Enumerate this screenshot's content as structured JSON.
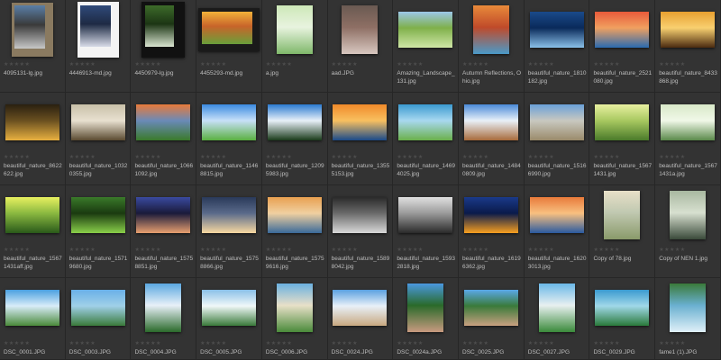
{
  "browser": {
    "rating_glyphs": "★★★★★",
    "items": [
      {
        "name": "4095131-lg.jpg",
        "orient": "port",
        "frame": "grey",
        "colors": [
          "#5a7fa8",
          "#c7c7c7",
          "#3a3a3a"
        ]
      },
      {
        "name": "4446913-md.jpg",
        "orient": "port",
        "frame": "white",
        "colors": [
          "#2f4a7a",
          "#d8dce8",
          "#1e2a44"
        ]
      },
      {
        "name": "4450979-lg.jpg",
        "orient": "port",
        "frame": "black",
        "colors": [
          "#3d6b2a",
          "#d9e4d0",
          "#1c3514"
        ]
      },
      {
        "name": "4455293-md.jpg",
        "orient": "land",
        "frame": "dark",
        "colors": [
          "#f2b13a",
          "#6aa03a",
          "#c8642a"
        ]
      },
      {
        "name": "a.jpg",
        "orient": "port",
        "frame": "none",
        "colors": [
          "#cde8b8",
          "#7fb86a",
          "#e8f3df"
        ]
      },
      {
        "name": "aad.JPG",
        "orient": "port",
        "frame": "none",
        "colors": [
          "#6a5a52",
          "#d8c8c0",
          "#8e6f64"
        ]
      },
      {
        "name": "Amazing_Landscape_131.jpg",
        "orient": "land",
        "frame": "none",
        "colors": [
          "#9cc8e8",
          "#cfe6a6",
          "#7fb04a"
        ]
      },
      {
        "name": "Autumn Reflections, Ohio.jpg",
        "orient": "port",
        "frame": "none",
        "colors": [
          "#e88a3a",
          "#4a9ac8",
          "#c04a2a"
        ]
      },
      {
        "name": "beautiful_nature_1810182.jpg",
        "orient": "land",
        "frame": "none",
        "colors": [
          "#1a4a8a",
          "#8ac0e8",
          "#0a2a5a"
        ]
      },
      {
        "name": "beautiful_nature_2521080.jpg",
        "orient": "land",
        "frame": "none",
        "colors": [
          "#e85a3a",
          "#2a6ab0",
          "#f0a060"
        ]
      },
      {
        "name": "beautiful_nature_8433868.jpg",
        "orient": "land",
        "frame": "none",
        "colors": [
          "#e8a030",
          "#4a2a10",
          "#f8d070"
        ]
      },
      {
        "name": "beautiful_nature_8622622.jpg",
        "orient": "land",
        "frame": "none",
        "colors": [
          "#2a2010",
          "#e8b040",
          "#6a5020"
        ]
      },
      {
        "name": "beautiful_nature_10320355.jpg",
        "orient": "land",
        "frame": "none",
        "colors": [
          "#c8c0a8",
          "#5a4a30",
          "#e8e0d0"
        ]
      },
      {
        "name": "beautiful_nature_10661092.jpg",
        "orient": "land",
        "frame": "none",
        "colors": [
          "#e87a3a",
          "#3a7a2a",
          "#6a8ab8"
        ]
      },
      {
        "name": "beautiful_nature_11468815.jpg",
        "orient": "land",
        "frame": "none",
        "colors": [
          "#3a8ae0",
          "#5ab040",
          "#c8e0f8"
        ]
      },
      {
        "name": "beautiful_nature_12095983.jpg",
        "orient": "land",
        "frame": "none",
        "colors": [
          "#2a7ad0",
          "#1a3a1a",
          "#e8f0f8"
        ]
      },
      {
        "name": "beautiful_nature_13555153.jpg",
        "orient": "land",
        "frame": "none",
        "colors": [
          "#f08a2a",
          "#1a4a8a",
          "#f8c060"
        ]
      },
      {
        "name": "beautiful_nature_14694025.jpg",
        "orient": "land",
        "frame": "none",
        "colors": [
          "#3a9ad0",
          "#6ab04a",
          "#a8d8f0"
        ]
      },
      {
        "name": "beautiful_nature_14840809.jpg",
        "orient": "land",
        "frame": "none",
        "colors": [
          "#4a8ad8",
          "#a86a3a",
          "#e8f0f8"
        ]
      },
      {
        "name": "beautiful_nature_15166990.jpg",
        "orient": "land",
        "frame": "none",
        "colors": [
          "#6aa0d8",
          "#9a8a6a",
          "#c8c8c0"
        ]
      },
      {
        "name": "beautiful_nature_15671431.jpg",
        "orient": "land",
        "frame": "none",
        "colors": [
          "#e8f0a0",
          "#4a7a2a",
          "#a8c860"
        ]
      },
      {
        "name": "beautiful_nature_15671431a.jpg",
        "orient": "land",
        "frame": "none",
        "colors": [
          "#d8e8c8",
          "#5a8a4a",
          "#f0f8e8"
        ]
      },
      {
        "name": "beautiful_nature_15671431aff.jpg",
        "orient": "land",
        "frame": "none",
        "colors": [
          "#e8f060",
          "#2a5a1a",
          "#8ab840"
        ]
      },
      {
        "name": "beautiful_nature_15719680.jpg",
        "orient": "land",
        "frame": "none",
        "colors": [
          "#3a7a2a",
          "#8ad04a",
          "#1a3a10"
        ]
      },
      {
        "name": "beautiful_nature_15758851.jpg",
        "orient": "land",
        "frame": "none",
        "colors": [
          "#3a4aa0",
          "#e8a070",
          "#1a1a3a"
        ]
      },
      {
        "name": "beautiful_nature_15758866.jpg",
        "orient": "land",
        "frame": "none",
        "colors": [
          "#2a3a5a",
          "#f8d8a0",
          "#5a6a8a"
        ]
      },
      {
        "name": "beautiful_nature_15759616.jpg",
        "orient": "land",
        "frame": "none",
        "colors": [
          "#e8a050",
          "#3a6a9a",
          "#f0d0a0"
        ]
      },
      {
        "name": "beautiful_nature_15898042.jpg",
        "orient": "land",
        "frame": "none",
        "colors": [
          "#2a2a2a",
          "#d8d8d8",
          "#6a6a6a"
        ]
      },
      {
        "name": "beautiful_nature_15932818.jpg",
        "orient": "land",
        "frame": "none",
        "colors": [
          "#e0e0e0",
          "#2a2a2a",
          "#9a9a9a"
        ]
      },
      {
        "name": "beautiful_nature_16196362.jpg",
        "orient": "land",
        "frame": "none",
        "colors": [
          "#1a3a8a",
          "#f8a020",
          "#0a1a4a"
        ]
      },
      {
        "name": "beautiful_nature_16203013.jpg",
        "orient": "land",
        "frame": "none",
        "colors": [
          "#e87a3a",
          "#2a5aa0",
          "#f8c080"
        ]
      },
      {
        "name": "Copy of 78.jpg",
        "orient": "port",
        "frame": "none",
        "colors": [
          "#e8e0c8",
          "#8a9a6a",
          "#c0c8b0"
        ]
      },
      {
        "name": "Copy of NEN 1.jpg",
        "orient": "port",
        "frame": "none",
        "colors": [
          "#a8b8a0",
          "#3a4a3a",
          "#d8e0d0"
        ]
      },
      {
        "name": "DSC_0001.JPG",
        "orient": "land",
        "frame": "none",
        "colors": [
          "#4aa0e0",
          "#4a8a3a",
          "#d8ecf8"
        ]
      },
      {
        "name": "DSC_0003.JPG",
        "orient": "land",
        "frame": "none",
        "colors": [
          "#6ab0e8",
          "#3a7a3a",
          "#a0d0e8"
        ]
      },
      {
        "name": "DSC_0004.JPG",
        "orient": "port",
        "frame": "none",
        "colors": [
          "#5aa8e0",
          "#2a6a2a",
          "#e8f0f8"
        ]
      },
      {
        "name": "DSC_0005.JPG",
        "orient": "land",
        "frame": "none",
        "colors": [
          "#8ac0e8",
          "#3a7a3a",
          "#f0f8f8"
        ]
      },
      {
        "name": "DSC_0006.JPG",
        "orient": "port",
        "frame": "none",
        "colors": [
          "#6ab0e0",
          "#4a8a3a",
          "#e8e0c8"
        ]
      },
      {
        "name": "DSC_0024.JPG",
        "orient": "land",
        "frame": "none",
        "colors": [
          "#5aa0e0",
          "#c8a880",
          "#e8f0f8"
        ]
      },
      {
        "name": "DSC_0024a.JPG",
        "orient": "port",
        "frame": "none",
        "colors": [
          "#4a98e0",
          "#c89a80",
          "#2a6a2a"
        ]
      },
      {
        "name": "DSC_0025.JPG",
        "orient": "land",
        "frame": "none",
        "colors": [
          "#5aa8e8",
          "#c8a080",
          "#3a7a3a"
        ]
      },
      {
        "name": "DSC_0027.JPG",
        "orient": "port",
        "frame": "none",
        "colors": [
          "#6ab8e8",
          "#3a8a3a",
          "#e8f0f0"
        ]
      },
      {
        "name": "DSC_0029.JPG",
        "orient": "land",
        "frame": "none",
        "colors": [
          "#3a9ad0",
          "#2a7a3a",
          "#a0d8e8"
        ]
      },
      {
        "name": "fame1 (1).JPG",
        "orient": "port",
        "frame": "none",
        "colors": [
          "#3a7a3a",
          "#e0f0f8",
          "#6ab0d0"
        ]
      }
    ]
  }
}
